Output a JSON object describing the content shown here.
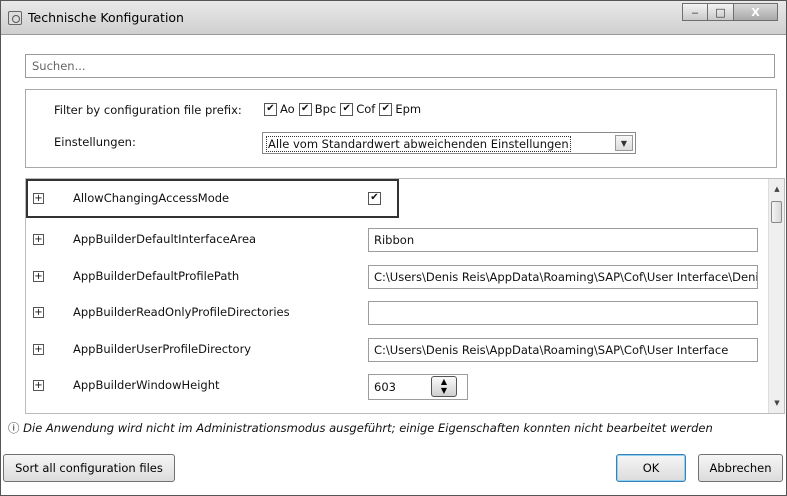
{
  "window": {
    "title": "Technische Konfiguration",
    "controls": {
      "minimize": "‒",
      "maximize": "□",
      "close": "X"
    }
  },
  "search": {
    "placeholder": "Suchen..."
  },
  "filter": {
    "prefix_label": "Filter by configuration file prefix:",
    "prefixes": [
      {
        "label": "Ao",
        "checked": true
      },
      {
        "label": "Bpc",
        "checked": true
      },
      {
        "label": "Cof",
        "checked": true
      },
      {
        "label": "Epm",
        "checked": true
      }
    ],
    "settings_label": "Einstellungen:",
    "settings_value": "Alle vom Standardwert abweichenden Einstellungen"
  },
  "settings_list": [
    {
      "name": "AllowChangingAccessMode",
      "type": "checkbox",
      "checked": true,
      "expander": "+"
    },
    {
      "name": "AppBuilderDefaultInterfaceArea",
      "type": "text",
      "value": "Ribbon",
      "expander": "+"
    },
    {
      "name": "AppBuilderDefaultProfilePath",
      "type": "text",
      "value": "C:\\Users\\Denis Reis\\AppData\\Roaming\\SAP\\Cof\\User Interface\\Denis",
      "expander": "+"
    },
    {
      "name": "AppBuilderReadOnlyProfileDirectories",
      "type": "text",
      "value": "",
      "expander": "+"
    },
    {
      "name": "AppBuilderUserProfileDirectory",
      "type": "text",
      "value": "C:\\Users\\Denis Reis\\AppData\\Roaming\\SAP\\Cof\\User Interface",
      "expander": "+"
    },
    {
      "name": "AppBuilderWindowHeight",
      "type": "spinner",
      "value": "603",
      "expander": "+"
    }
  ],
  "info": {
    "icon": "ⓘ",
    "text": "Die Anwendung wird nicht im Administrationsmodus ausgeführt; einige Eigenschaften konnten nicht bearbeitet werden"
  },
  "buttons": {
    "sort": "Sort all configuration files",
    "ok": "OK",
    "cancel": "Abbrechen"
  }
}
